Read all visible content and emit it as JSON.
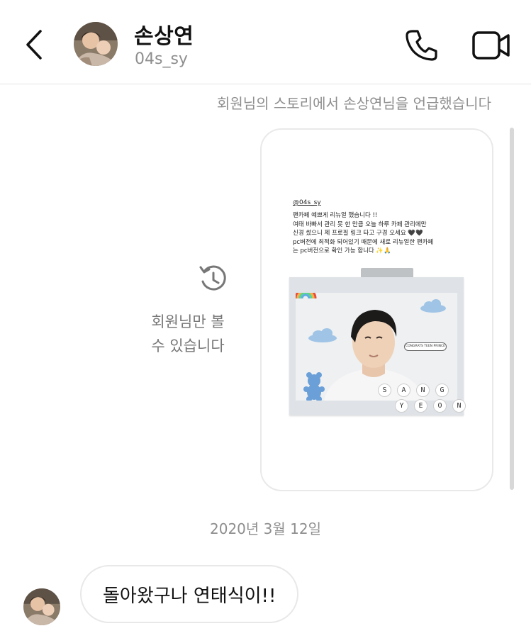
{
  "header": {
    "title": "손상연",
    "subtitle": "04s_sy"
  },
  "messages": {
    "mention_notice": "회원님의 스토리에서 손상연님을 언급했습니다",
    "private_notice": "회원님만 볼\n수 있습니다",
    "date": "2020년 3월 12일",
    "bubble_text": "돌아왔구나 연태식이!!"
  },
  "story": {
    "handle": "@04s_sy",
    "lines": [
      "팬카페 예쁘게 리뉴얼 했습니다 !!",
      "여태 바빠서 관리 못 한 만큼 오늘 하루 카페 관리에만",
      "신경 썼으니 제 프로필 링크 타고 구경 오세요 🖤🖤",
      "pc버전에 최적화 되어있기 때문에 새로 리뉴얼한 팬카페",
      "는 pc버전으로 확인 가능 합니다 ✨🙏"
    ],
    "tag": "CONGRATS TEEN PRINCE",
    "letters_top": [
      "S",
      "A",
      "N",
      "G"
    ],
    "letters_bottom": [
      "Y",
      "E",
      "O",
      "N"
    ]
  },
  "colors": {
    "accent": "#111111",
    "muted": "#8e8e8e",
    "border": "#e8e8e8"
  },
  "icons": [
    "chevron-left-icon",
    "phone-icon",
    "video-camera-icon",
    "history-icon"
  ]
}
